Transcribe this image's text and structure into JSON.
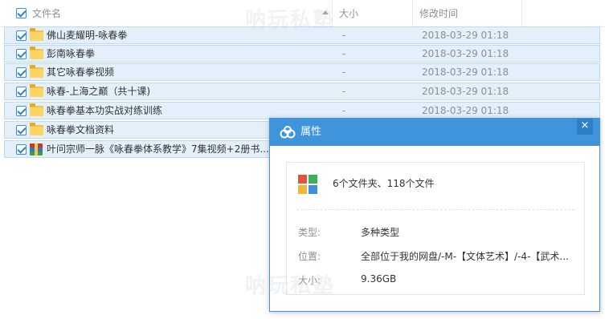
{
  "header": {
    "name_label": "文件名",
    "size_label": "大小",
    "date_label": "修改时间"
  },
  "files": [
    {
      "name": "佛山麦耀明-咏春拳",
      "size": "-",
      "date": "2018-03-29 01:18",
      "type": "folder"
    },
    {
      "name": "彭南咏春拳",
      "size": "-",
      "date": "2018-03-29 01:18",
      "type": "folder"
    },
    {
      "name": "其它咏春拳视频",
      "size": "-",
      "date": "2018-03-29 01:18",
      "type": "folder"
    },
    {
      "name": "咏春-上海之巅（共十课)",
      "size": "-",
      "date": "2018-03-29 01:18",
      "type": "folder"
    },
    {
      "name": "咏春拳基本功实战对练训练",
      "size": "-",
      "date": "2018-03-29 01:18",
      "type": "folder"
    },
    {
      "name": "咏春拳文档资料",
      "size": "-",
      "date": "",
      "type": "folder"
    },
    {
      "name": "叶问宗师一脉《咏春拳体系教学》7集视频+2册书....",
      "size": "",
      "date": "",
      "type": "archive"
    }
  ],
  "dialog": {
    "title": "属性",
    "close": "×",
    "summary": "6个文件夹、118个文件",
    "type_label": "类型:",
    "type_value": "多种类型",
    "location_label": "位置:",
    "location_value": "全部位于我的网盘/-M-【文体艺术】/-4-【武术...",
    "size_label": "大小:",
    "size_value": "9.36GB"
  },
  "watermark": "呐玩私塾",
  "colors": {
    "accent": "#3f94dc",
    "row_selected": "#e3effb",
    "folder": "#f7c245"
  }
}
